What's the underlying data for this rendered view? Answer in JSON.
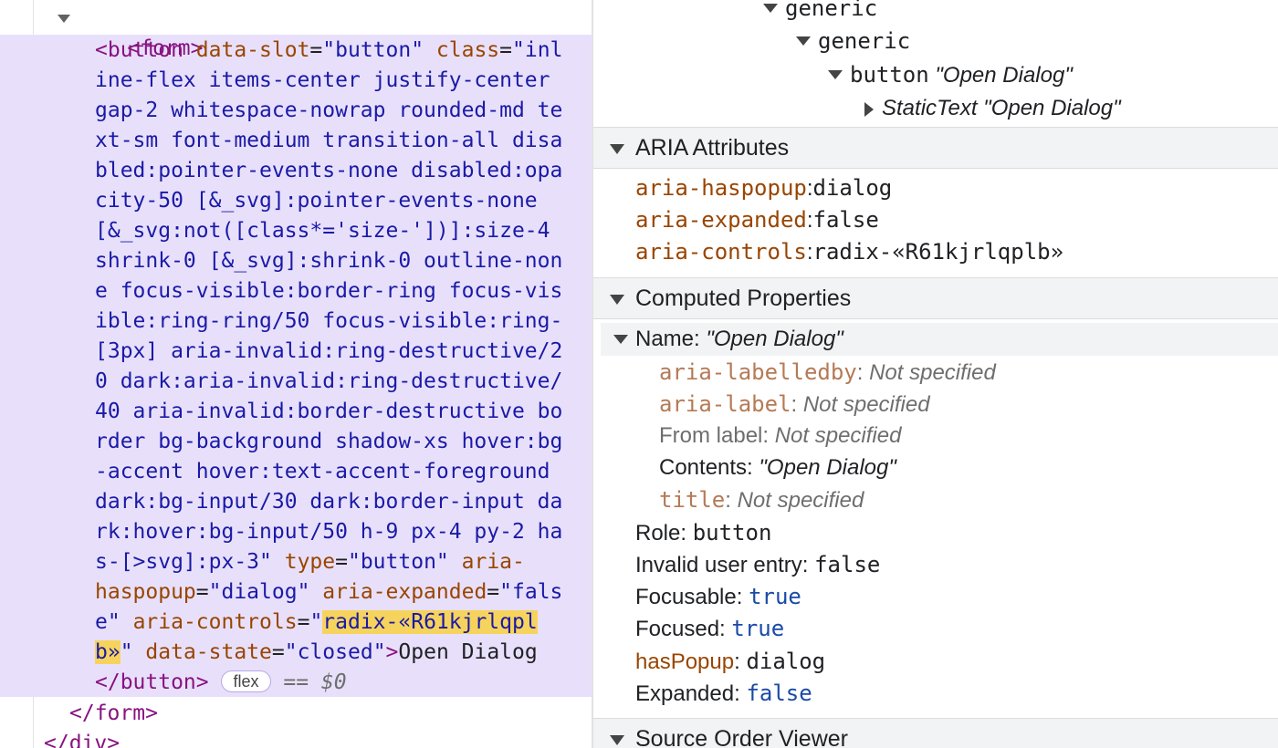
{
  "elements": {
    "form_open": "<form>",
    "button_tag": "<button",
    "attr_data_slot": "data-slot",
    "val_data_slot": "\"button\"",
    "attr_class": "class",
    "class_lines": [
      "\"inl",
      "ine-flex items-center justify-center",
      "gap-2 whitespace-nowrap rounded-md te",
      "xt-sm font-medium transition-all disa",
      "bled:pointer-events-none disabled:opa",
      "city-50 [&_svg]:pointer-events-none",
      "[&_svg:not([class*='size-'])]:size-4",
      "shrink-0 [&_svg]:shrink-0 outline-non",
      "e focus-visible:border-ring focus-vis",
      "ible:ring-ring/50 focus-visible:ring-",
      "[3px] aria-invalid:ring-destructive/2",
      "0 dark:aria-invalid:ring-destructive/",
      "40 aria-invalid:border-destructive bo",
      "rder bg-background shadow-xs hover:bg",
      "-accent hover:text-accent-foreground",
      "dark:bg-input/30 dark:border-input da",
      "rk:hover:bg-input/50 h-9 px-4 py-2 ha",
      "s-[>svg]:px-3\""
    ],
    "attr_type": "type",
    "val_type": "\"button\"",
    "attr_aria_a": "aria-",
    "attr_aria_b": "haspopup",
    "val_haspopup": "\"dialog\"",
    "attr_expanded": "aria-expanded",
    "val_expanded_a": "\"fals",
    "val_expanded_b": "e\"",
    "attr_controls": "aria-controls",
    "val_controls_hl_a": "radix-«R61kjrlqpl",
    "val_controls_hl_b": "b»",
    "attr_state": "data-state",
    "val_state": "\"closed\"",
    "button_text": "Open Dialog",
    "button_close": "</button>",
    "badge": "flex",
    "eq_label": "== ",
    "dollar_label": "$0",
    "form_close": "</form>",
    "div_close": "</div>"
  },
  "accessibility": {
    "tree": {
      "generic1": "generic",
      "generic2": "generic",
      "button_role": "button",
      "button_name": "\"Open Dialog\"",
      "static_role": "StaticText",
      "static_name": "\"Open Dialog\""
    },
    "aria_section_title": "ARIA Attributes",
    "aria_attributes": [
      {
        "key": "aria-haspopup",
        "value": "dialog"
      },
      {
        "key": "aria-expanded",
        "value": "false"
      },
      {
        "key": "aria-controls",
        "value": "radix-«R61kjrlqplb»"
      }
    ],
    "computed_section_title": "Computed Properties",
    "name_label": "Name:",
    "name_value": "\"Open Dialog\"",
    "name_sources": {
      "labelledby_key": "aria-labelledby",
      "labelledby_value": "Not specified",
      "label_key": "aria-label",
      "label_value": "Not specified",
      "from_label_key": "From label:",
      "from_label_value": "Not specified",
      "contents_key": "Contents:",
      "contents_value": "\"Open Dialog\"",
      "title_key": "title",
      "title_value": "Not specified"
    },
    "role_label": "Role:",
    "role_value": "button",
    "invalid_label": "Invalid user entry:",
    "invalid_value": "false",
    "focusable_label": "Focusable:",
    "focusable_value": "true",
    "focused_label": "Focused:",
    "focused_value": "true",
    "haspopup_label": "hasPopup",
    "haspopup_value": "dialog",
    "expanded_label": "Expanded:",
    "expanded_value": "false",
    "source_order_title": "Source Order Viewer",
    "colon": ":"
  }
}
